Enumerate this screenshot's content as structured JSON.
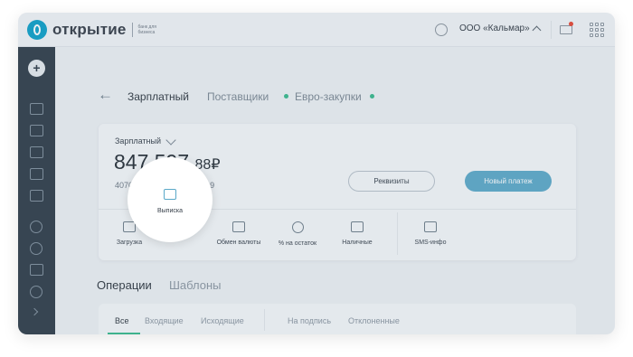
{
  "header": {
    "logo_text": "открытие",
    "logo_subtitle": "банк для бизнеса",
    "company": "ООО «Кальмар»"
  },
  "accounts": {
    "tabs": [
      {
        "label": "Зарплатный"
      },
      {
        "label": "Поставщики"
      },
      {
        "label": "Евро-закупки"
      }
    ]
  },
  "card": {
    "account_name": "Зарплатный",
    "balance_main": "847 597,",
    "balance_cents": "88₽",
    "account_number": "40702 810 2050 1000 0019",
    "requisites_label": "Реквизиты",
    "new_payment_label": "Новый платеж"
  },
  "actions": [
    {
      "label": "Загрузка",
      "icon": "upload-icon"
    },
    {
      "label": "Выписка",
      "icon": "statement-icon"
    },
    {
      "label": "Обмен валюты",
      "icon": "currency-exchange-icon"
    },
    {
      "label": "% на остаток",
      "icon": "percent-icon"
    },
    {
      "label": "Наличные",
      "icon": "cash-icon"
    },
    {
      "label": "SMS-инфо",
      "icon": "sms-icon"
    }
  ],
  "sections": {
    "operations": "Операции",
    "templates": "Шаблоны"
  },
  "filters": {
    "all": "Все",
    "incoming": "Входящие",
    "outgoing": "Исходящие",
    "to_sign": "На подпись",
    "rejected": "Отклоненные"
  },
  "colors": {
    "accent": "#5aa8c8",
    "sidebar": "#2d3a45",
    "status_dot": "#35b88a",
    "notification": "#e8432f"
  }
}
